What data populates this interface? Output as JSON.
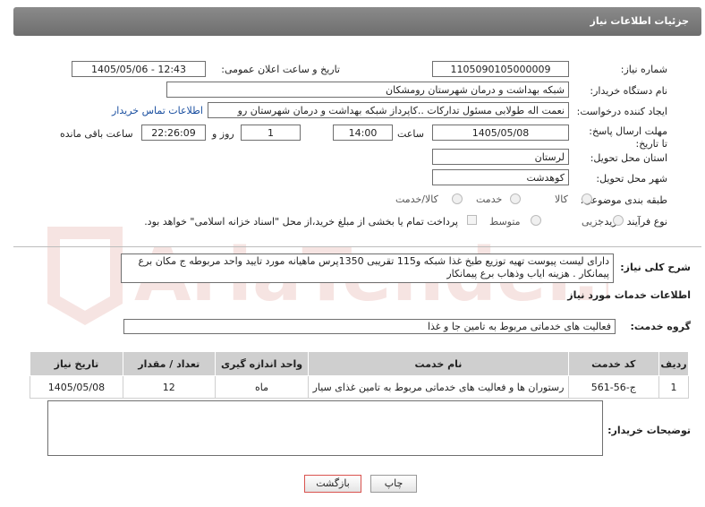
{
  "header": {
    "title": "جزئیات اطلاعات نیاز"
  },
  "fields": {
    "need_number_label": "شماره نیاز:",
    "need_number": "1105090105000009",
    "announce_label": "تاریخ و ساعت اعلان عمومی:",
    "announce_value": "1405/05/06 - 12:43",
    "buyer_org_label": "نام دستگاه خریدار:",
    "buyer_org": "شبکه بهداشت و درمان شهرستان رومشکان",
    "creator_label": "ایجاد کننده درخواست:",
    "creator": "نعمت اله طولابی مسئول تدارکات ..کاپرداز شبکه بهداشت و درمان شهرستان رو",
    "contact_link": "اطلاعات تماس خریدار",
    "deadline_label": "مهلت ارسال پاسخ: تا تاریخ:",
    "deadline_date": "1405/05/08",
    "time_label": "ساعت",
    "deadline_time": "14:00",
    "days_value": "1",
    "days_label": "روز و",
    "remaining_time": "22:26:09",
    "remaining_label": "ساعت باقی مانده",
    "province_label": "استان محل تحویل:",
    "province": "لرستان",
    "city_label": "شهر محل تحویل:",
    "city": "کوهدشت",
    "category_label": "طبقه بندی موضوعی:",
    "category_options": [
      "کالا",
      "خدمت",
      "کالا/خدمت"
    ],
    "process_label": "نوع فرآیند خرید :",
    "process_options": [
      "جزیی",
      "متوسط"
    ],
    "payment_note": "پرداخت تمام یا بخشی از مبلغ خرید،از محل \"اسناد خزانه اسلامی\" خواهد بود."
  },
  "description": {
    "label": "شرح کلی نیاز:",
    "text": "دارای لیست پیوست تهیه توزیع طبخ غذا شبکه  و115 تقریبی 1350پرس ماهیانه  مورد تایید واحد مربوطه ج مکان برع پیمانکار . هزینه ایاب وذهاب برع پیمانکار"
  },
  "services": {
    "section_title": "اطلاعات خدمات مورد نیاز",
    "group_label": "گروه خدمت:",
    "group_value": "فعالیت های خدماتی مربوط به تامین جا و غذا",
    "columns": [
      "ردیف",
      "کد خدمت",
      "نام خدمت",
      "واحد اندازه گیری",
      "تعداد / مقدار",
      "تاریخ نیاز"
    ],
    "rows": [
      [
        "1",
        "ج-56-561",
        "رستوران ها و فعالیت های خدماتی مربوط به تامین غذای سیار",
        "ماه",
        "12",
        "1405/05/08"
      ]
    ]
  },
  "buyer_notes": {
    "label": "توضیحات خریدار:",
    "value": ""
  },
  "buttons": {
    "print": "چاپ",
    "back": "بازگشت"
  },
  "watermark": {
    "text": "AriaTender.net"
  },
  "colors": {
    "header_bg": "#7c7c7c",
    "link": "#1a4fa0",
    "table_header": "#cfcfcf",
    "back_button_border": "#d9534f"
  }
}
